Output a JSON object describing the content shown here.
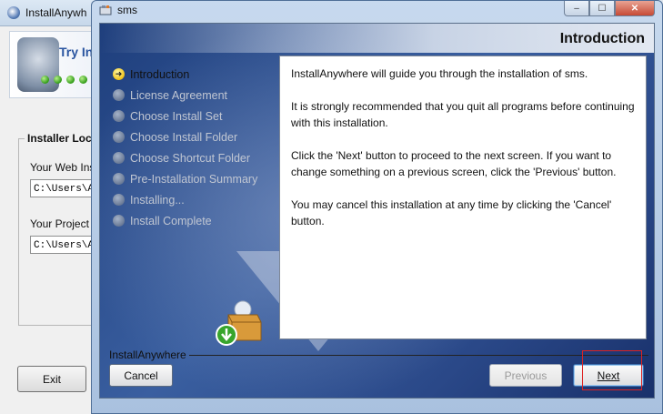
{
  "background_window": {
    "title": "InstallAnywh",
    "banner_text": "Try Ins",
    "group_label": "Installer Loca",
    "field1_label": "Your Web Ins",
    "field1_value": "C:\\Users\\Ad",
    "field2_label": "Your Project",
    "field2_value": "C:\\Users\\Ad",
    "exit_label": "Exit"
  },
  "window": {
    "title": "sms",
    "controls": {
      "minimize": "–",
      "maximize": "☐",
      "close": "✕"
    }
  },
  "page": {
    "heading": "Introduction"
  },
  "steps": [
    {
      "label": "Introduction",
      "current": true
    },
    {
      "label": "License Agreement",
      "current": false
    },
    {
      "label": "Choose Install Set",
      "current": false
    },
    {
      "label": "Choose Install Folder",
      "current": false
    },
    {
      "label": "Choose Shortcut Folder",
      "current": false
    },
    {
      "label": "Pre-Installation Summary",
      "current": false
    },
    {
      "label": "Installing...",
      "current": false
    },
    {
      "label": "Install Complete",
      "current": false
    }
  ],
  "content": {
    "paragraphs": [
      "InstallAnywhere will guide you through the installation of sms.",
      "It is strongly recommended that you quit all programs before continuing with this installation.",
      "Click the 'Next' button to proceed to the next screen. If you want to change something on a previous screen, click the 'Previous' button.",
      "You may cancel this installation at any time by clicking the 'Cancel' button."
    ]
  },
  "footer": {
    "brand": "InstallAnywhere",
    "cancel_label": "Cancel",
    "previous_label": "Previous",
    "next_label": "Next"
  },
  "icons": {
    "app": "installer-icon",
    "current_step": "arrow-right-icon",
    "pending_step": "circle-icon",
    "box": "package-download-icon"
  },
  "colors": {
    "panel_blue": "#2a4888",
    "current_step_marker": "#f0c21a",
    "highlight": "#dd2222"
  }
}
